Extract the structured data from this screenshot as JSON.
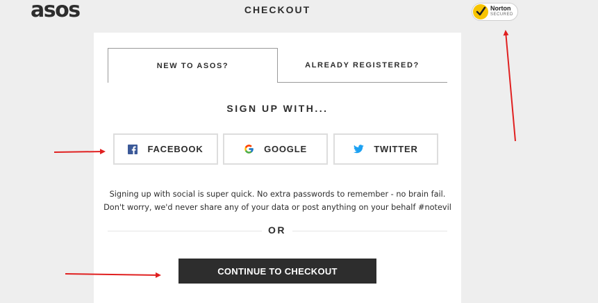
{
  "header": {
    "logo_text": "asos",
    "title": "CHECKOUT",
    "badge": {
      "brand": "Norton",
      "sub": "SECURED",
      "icon": "checkmark-icon"
    }
  },
  "tabs": [
    {
      "label": "NEW TO ASOS?",
      "active": true
    },
    {
      "label": "ALREADY REGISTERED?",
      "active": false
    }
  ],
  "signup": {
    "heading": "SIGN UP WITH...",
    "buttons": [
      {
        "label": "FACEBOOK",
        "icon": "facebook-icon",
        "color": "#3b5998"
      },
      {
        "label": "GOOGLE",
        "icon": "google-icon",
        "color": "#4285f4"
      },
      {
        "label": "TWITTER",
        "icon": "twitter-icon",
        "color": "#1da1f2"
      }
    ],
    "disclaimer_line1": "Signing up with social is super quick. No extra passwords to remember - no brain fail.",
    "disclaimer_line2": "Don't worry, we'd never share any of your data or post anything on your behalf #notevil"
  },
  "divider": {
    "label": "OR"
  },
  "cta": {
    "label": "CONTINUE TO CHECKOUT"
  },
  "colors": {
    "background": "#eeeeee",
    "panel": "#ffffff",
    "text": "#2d2d2d",
    "cta_bg": "#2d2d2d",
    "annotation_arrow": "#e02020",
    "norton_yellow": "#f7c400"
  }
}
